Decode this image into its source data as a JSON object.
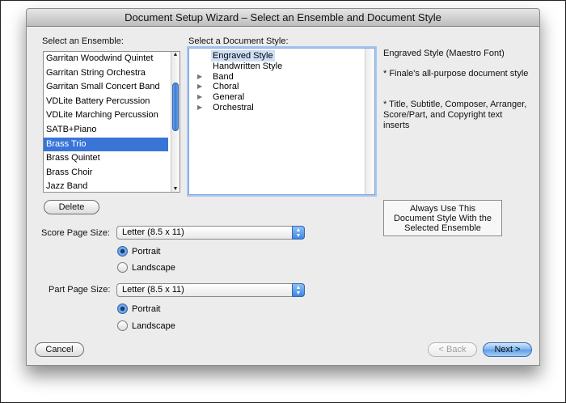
{
  "window": {
    "title": "Document Setup Wizard – Select an Ensemble and Document Style"
  },
  "ensemble": {
    "label": "Select an Ensemble:",
    "items": [
      "Garritan Woodwind Quintet",
      "Garritan String Orchestra",
      "Garritan Small Concert Band",
      "VDLite Battery Percussion",
      "VDLite Marching Percussion",
      "SATB+Piano",
      "Brass Trio",
      "Brass Quintet",
      "Brass Choir",
      "Jazz Band"
    ],
    "selected": "Brass Trio",
    "delete_label": "Delete"
  },
  "doc_style": {
    "label": "Select a Document Style:",
    "items": [
      {
        "label": "Engraved Style",
        "expandable": false,
        "selected": true
      },
      {
        "label": "Handwritten Style",
        "expandable": false,
        "selected": false
      },
      {
        "label": "Band",
        "expandable": true,
        "selected": false
      },
      {
        "label": "Choral",
        "expandable": true,
        "selected": false
      },
      {
        "label": "General",
        "expandable": true,
        "selected": false
      },
      {
        "label": "Orchestral",
        "expandable": true,
        "selected": false
      }
    ]
  },
  "description": {
    "title": "Engraved Style (Maestro Font)",
    "line1": "* Finale's all-purpose document style",
    "line2": "* Title, Subtitle, Composer, Arranger, Score/Part, and Copyright text inserts"
  },
  "always_use_label": "Always Use This Document Style With the Selected Ensemble",
  "score_page": {
    "label": "Score Page Size:",
    "value": "Letter (8.5 x 11)",
    "portrait_label": "Portrait",
    "landscape_label": "Landscape",
    "orientation": "Portrait"
  },
  "part_page": {
    "label": "Part Page Size:",
    "value": "Letter (8.5 x 11)",
    "portrait_label": "Portrait",
    "landscape_label": "Landscape",
    "orientation": "Portrait"
  },
  "footer": {
    "cancel_label": "Cancel",
    "back_label": "< Back",
    "next_label": "Next >"
  }
}
